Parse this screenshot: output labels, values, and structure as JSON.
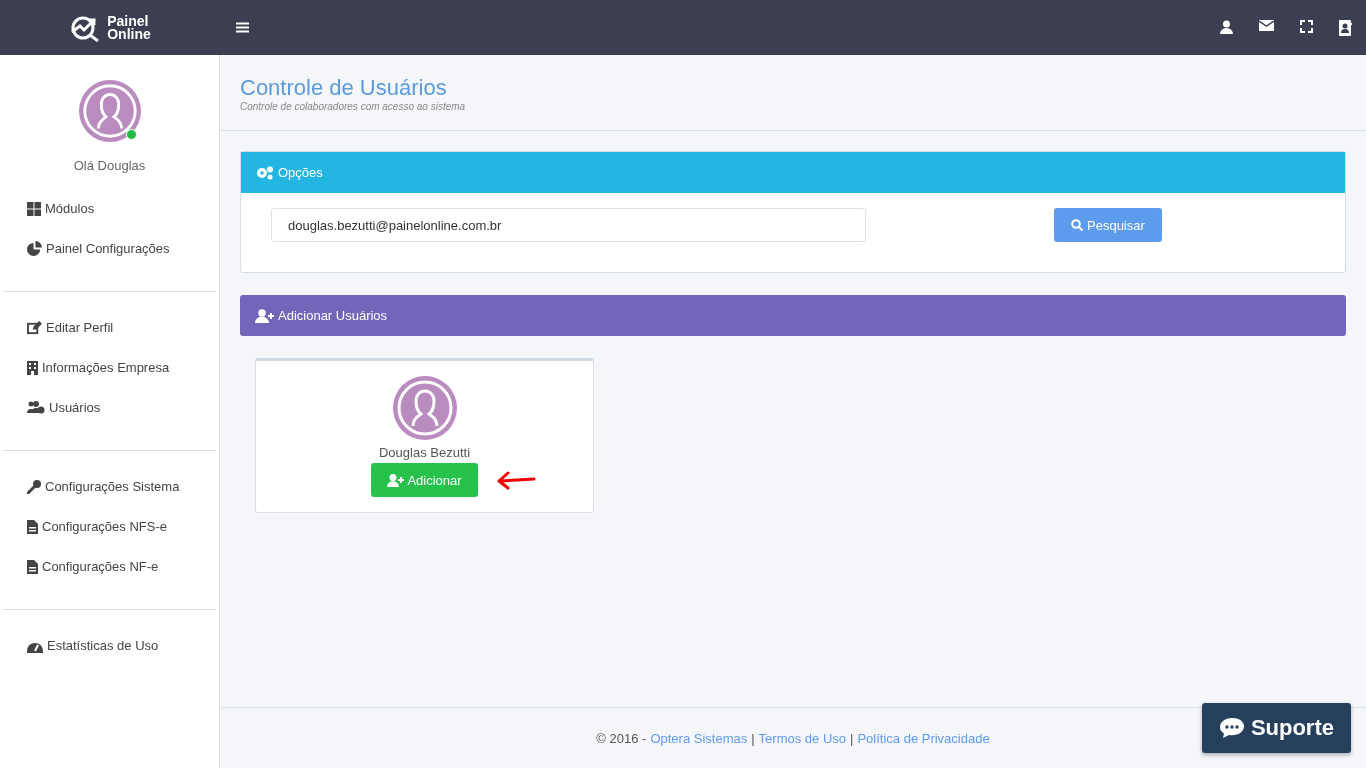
{
  "logo": {
    "line1": "Painel",
    "line2": "Online"
  },
  "user": {
    "greeting": "Olá Douglas",
    "online": true
  },
  "sidebar": {
    "groups": [
      [
        {
          "label": "Módulos"
        },
        {
          "label": "Painel Configurações"
        }
      ],
      [
        {
          "label": "Editar Perfil"
        },
        {
          "label": "Informações Empresa"
        },
        {
          "label": "Usuários"
        }
      ],
      [
        {
          "label": "Configurações Sistema"
        },
        {
          "label": "Configurações NFS-e"
        },
        {
          "label": "Configurações NF-e"
        }
      ],
      [
        {
          "label": "Estatísticas de Uso"
        }
      ]
    ]
  },
  "page": {
    "title": "Controle de Usuários",
    "subtitle": "Controle de colaboradores com acesso ao sistema"
  },
  "options_panel": {
    "title": "Opções",
    "search_value": "douglas.bezutti@painelonline.com.br",
    "search_button": "Pesquisar"
  },
  "add_panel": {
    "title": "Adicionar Usuários",
    "users": [
      {
        "name": "Douglas Bezutti",
        "button": "Adicionar"
      }
    ]
  },
  "footer": {
    "prefix": "© 2016 -",
    "links": [
      "Optera Sistemas",
      "Termos de Uso",
      "Política de Privacidade"
    ],
    "separator": "|"
  },
  "support_button": "Suporte"
}
